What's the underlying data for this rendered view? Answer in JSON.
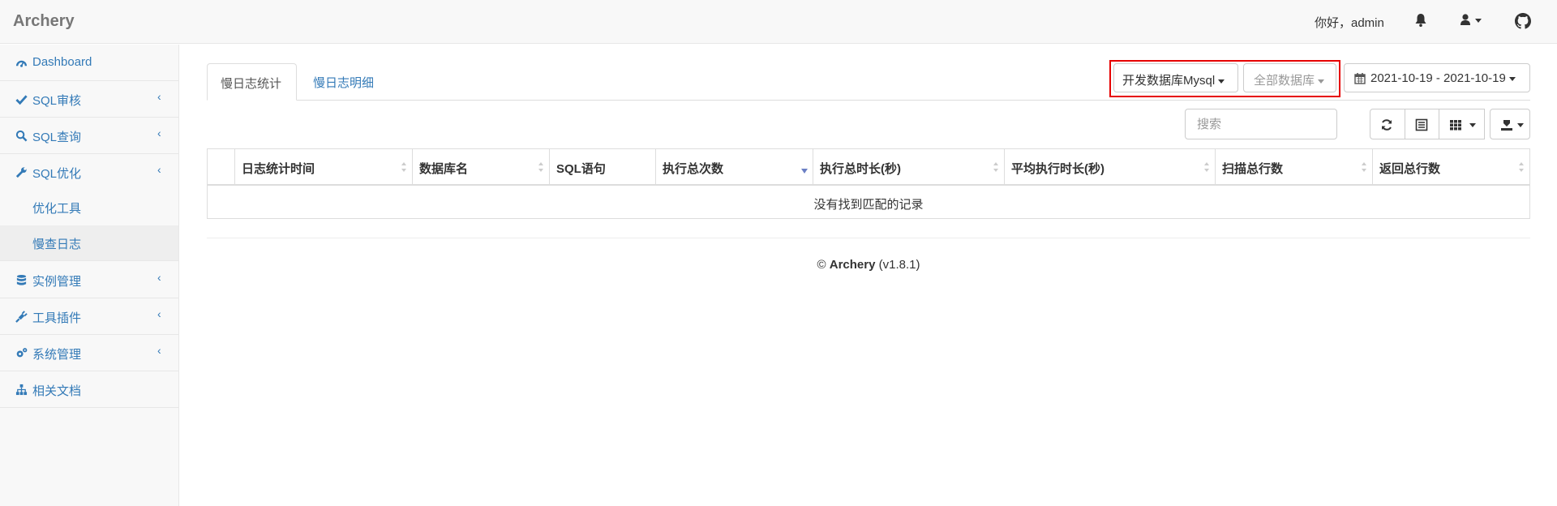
{
  "navbar": {
    "brand": "Archery",
    "greeting": "你好，admin"
  },
  "sidebar": {
    "items": [
      {
        "label": "Dashboard",
        "icon": "dashboard-icon"
      },
      {
        "label": "SQL审核",
        "icon": "check-icon"
      },
      {
        "label": "SQL查询",
        "icon": "search-icon"
      },
      {
        "label": "SQL优化",
        "icon": "wrench-icon"
      },
      {
        "label": "优化工具"
      },
      {
        "label": "慢查日志"
      },
      {
        "label": "实例管理",
        "icon": "database-icon"
      },
      {
        "label": "工具插件",
        "icon": "plug-icon"
      },
      {
        "label": "系统管理",
        "icon": "cogs-icon"
      },
      {
        "label": "相关文档",
        "icon": "sitemap-icon"
      }
    ],
    "chevron": "‹"
  },
  "tabs": [
    {
      "label": "慢日志统计",
      "active": true
    },
    {
      "label": "慢日志明细",
      "active": false
    }
  ],
  "filters": {
    "instance": "开发数据库Mysql",
    "database": "全部数据库",
    "date_range": "2021-10-19 - 2021-10-19"
  },
  "toolbar": {
    "search_placeholder": "搜索"
  },
  "table": {
    "columns": [
      "日志统计时间",
      "数据库名",
      "SQL语句",
      "执行总次数",
      "执行总时长(秒)",
      "平均执行时长(秒)",
      "扫描总行数",
      "返回总行数"
    ],
    "empty_text": "没有找到匹配的记录"
  },
  "footer": {
    "copyright": "©",
    "brand": "Archery",
    "version": "(v1.8.1)"
  },
  "colors": {
    "link": "#337ab7",
    "highlight_frame": "#e60000"
  }
}
